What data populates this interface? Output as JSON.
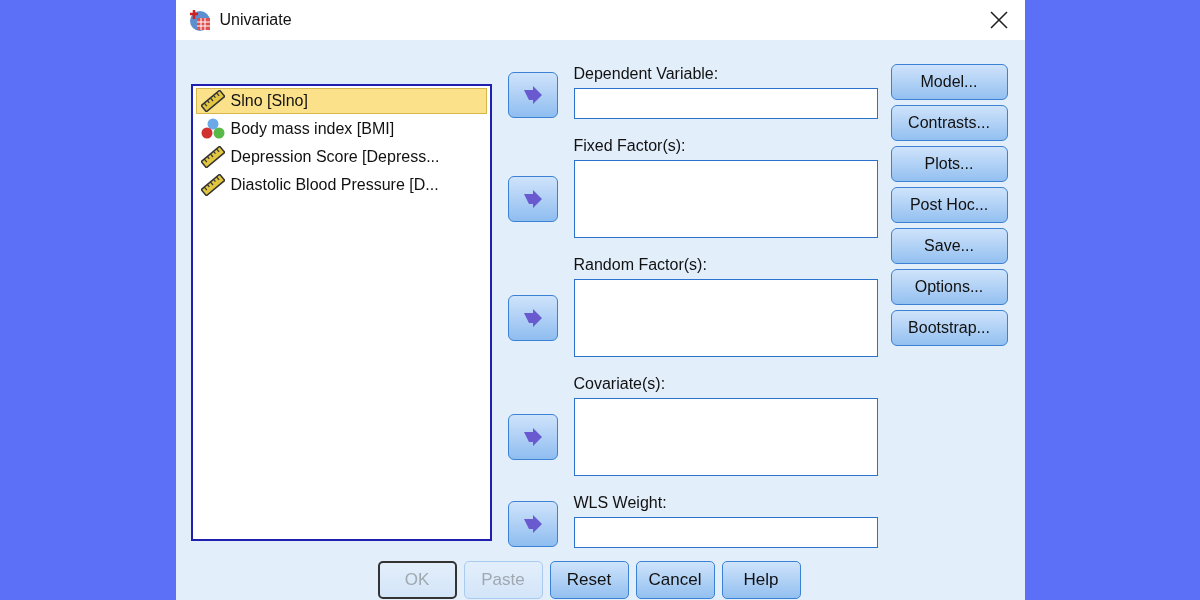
{
  "window": {
    "title": "Univariate"
  },
  "variables": [
    {
      "label": "Slno [Slno]",
      "kind": "scale",
      "selected": true
    },
    {
      "label": "Body mass index [BMI]",
      "kind": "nominal",
      "selected": false
    },
    {
      "label": "Depression Score [Depress...",
      "kind": "scale",
      "selected": false
    },
    {
      "label": "Diastolic Blood Pressure [D...",
      "kind": "scale",
      "selected": false
    }
  ],
  "targets": [
    {
      "label": "Dependent Variable:",
      "kind": "single"
    },
    {
      "label": "Fixed Factor(s):",
      "kind": "multi"
    },
    {
      "label": "Random Factor(s):",
      "kind": "multi"
    },
    {
      "label": "Covariate(s):",
      "kind": "multi"
    },
    {
      "label": "WLS Weight:",
      "kind": "single"
    }
  ],
  "side_buttons": [
    "Model...",
    "Contrasts...",
    "Plots...",
    "Post Hoc...",
    "Save...",
    "Options...",
    "Bootstrap..."
  ],
  "footer_buttons": [
    {
      "label": "OK",
      "disabled": true,
      "focused": true
    },
    {
      "label": "Paste",
      "disabled": true,
      "focused": false
    },
    {
      "label": "Reset",
      "disabled": false,
      "focused": false
    },
    {
      "label": "Cancel",
      "disabled": false,
      "focused": false
    },
    {
      "label": "Help",
      "disabled": false,
      "focused": false
    }
  ]
}
